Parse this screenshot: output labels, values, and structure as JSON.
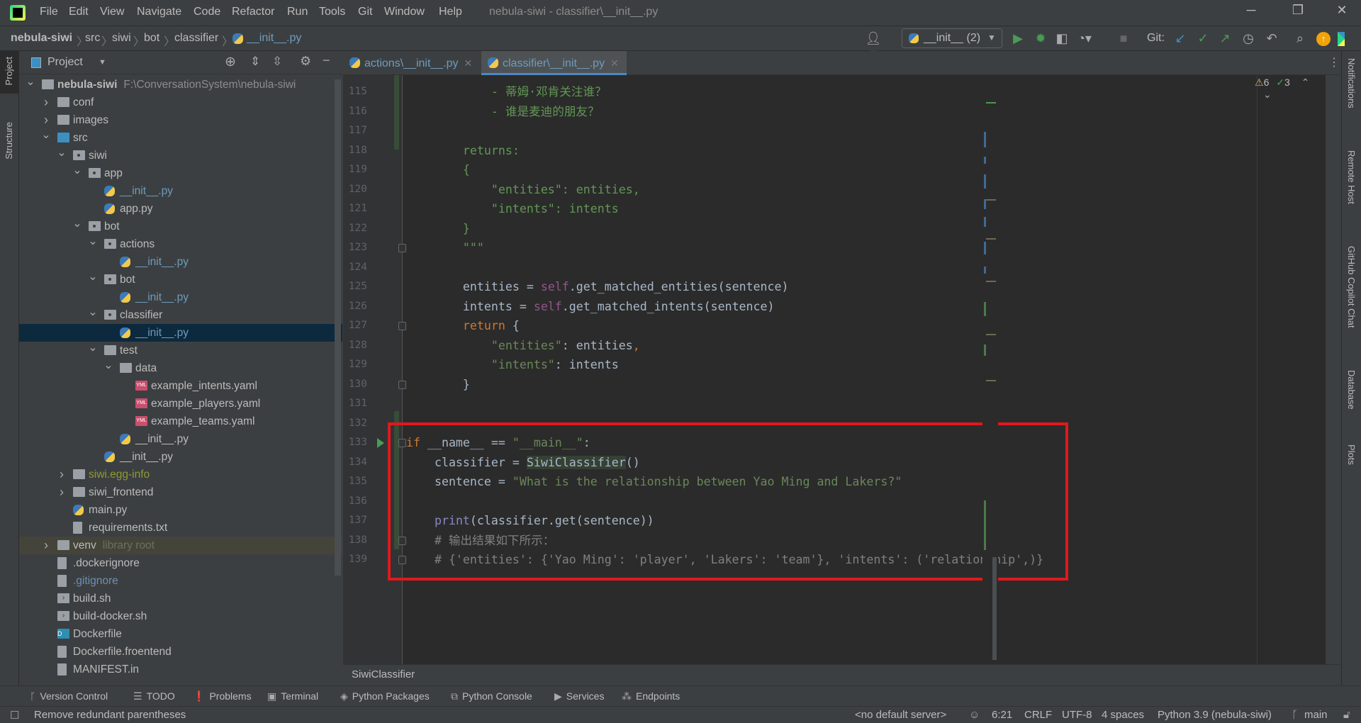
{
  "menu": [
    "File",
    "Edit",
    "View",
    "Navigate",
    "Code",
    "Refactor",
    "Run",
    "Tools",
    "Git",
    "Window",
    "Help"
  ],
  "window_title": "nebula-siwi - classifier\\__init__.py",
  "window_controls": {
    "minimize": "─",
    "restore": "❐",
    "close": "✕"
  },
  "breadcrumb": [
    "nebula-siwi",
    "src",
    "siwi",
    "bot",
    "classifier",
    "__init__.py"
  ],
  "toolbar": {
    "run_config": "__init__ (2)",
    "git_label": "Git:"
  },
  "left_stripe": {
    "project": "Project",
    "structure": "Structure"
  },
  "project_panel": {
    "title": "Project",
    "rows": [
      {
        "d": 0,
        "label": "nebula-siwi",
        "hint": "F:\\ConversationSystem\\nebula-siwi",
        "icon": "folder",
        "arrow": "down",
        "bold": true
      },
      {
        "d": 1,
        "label": "conf",
        "icon": "folder",
        "arrow": "right"
      },
      {
        "d": 1,
        "label": "images",
        "icon": "folder",
        "arrow": "right"
      },
      {
        "d": 1,
        "label": "src",
        "icon": "folder-blue",
        "arrow": "down"
      },
      {
        "d": 2,
        "label": "siwi",
        "icon": "pkg",
        "arrow": "down"
      },
      {
        "d": 3,
        "label": "app",
        "icon": "pkg",
        "arrow": "down"
      },
      {
        "d": 4,
        "label": "__init__.py",
        "icon": "py",
        "color": "#6d9cbe"
      },
      {
        "d": 4,
        "label": "app.py",
        "icon": "py"
      },
      {
        "d": 3,
        "label": "bot",
        "icon": "pkg",
        "arrow": "down"
      },
      {
        "d": 4,
        "label": "actions",
        "icon": "pkg",
        "arrow": "down"
      },
      {
        "d": 5,
        "label": "__init__.py",
        "icon": "py",
        "color": "#6d9cbe"
      },
      {
        "d": 4,
        "label": "bot",
        "icon": "pkg",
        "arrow": "down"
      },
      {
        "d": 5,
        "label": "__init__.py",
        "icon": "py",
        "color": "#6d9cbe"
      },
      {
        "d": 4,
        "label": "classifier",
        "icon": "pkg",
        "arrow": "down"
      },
      {
        "d": 5,
        "label": "__init__.py",
        "icon": "py",
        "color": "#6d9cbe",
        "selected": true
      },
      {
        "d": 4,
        "label": "test",
        "icon": "folder",
        "arrow": "down"
      },
      {
        "d": 5,
        "label": "data",
        "icon": "folder",
        "arrow": "down"
      },
      {
        "d": 6,
        "label": "example_intents.yaml",
        "icon": "yml"
      },
      {
        "d": 6,
        "label": "example_players.yaml",
        "icon": "yml"
      },
      {
        "d": 6,
        "label": "example_teams.yaml",
        "icon": "yml"
      },
      {
        "d": 5,
        "label": "__init__.py",
        "icon": "py"
      },
      {
        "d": 4,
        "label": "__init__.py",
        "icon": "py"
      },
      {
        "d": 2,
        "label": "siwi.egg-info",
        "icon": "folder",
        "arrow": "right",
        "color": "#8f9a2e"
      },
      {
        "d": 2,
        "label": "siwi_frontend",
        "icon": "folder",
        "arrow": "right"
      },
      {
        "d": 2,
        "label": "main.py",
        "icon": "py"
      },
      {
        "d": 2,
        "label": "requirements.txt",
        "icon": "txt"
      },
      {
        "d": 1,
        "label": "venv",
        "hint": "library root",
        "icon": "folder",
        "arrow": "right",
        "lib": true
      },
      {
        "d": 1,
        "label": ".dockerignore",
        "icon": "ign"
      },
      {
        "d": 1,
        "label": ".gitignore",
        "icon": "ign",
        "color": "#6d8fb5"
      },
      {
        "d": 1,
        "label": "build.sh",
        "icon": "sh"
      },
      {
        "d": 1,
        "label": "build-docker.sh",
        "icon": "sh"
      },
      {
        "d": 1,
        "label": "Dockerfile",
        "icon": "dock"
      },
      {
        "d": 1,
        "label": "Dockerfile.froentend",
        "icon": "txt"
      },
      {
        "d": 1,
        "label": "MANIFEST.in",
        "icon": "txt"
      }
    ]
  },
  "tabs": [
    {
      "label": "actions\\__init__.py",
      "active": false
    },
    {
      "label": "classifier\\__init__.py",
      "active": true
    }
  ],
  "inspections": {
    "warnings": "6",
    "typos": "3"
  },
  "code": [
    {
      "n": 115,
      "tokens": [
        [
          "            - 蒂姆·邓肯关注谁？",
          "doc"
        ]
      ]
    },
    {
      "n": 116,
      "tokens": [
        [
          "            - 谁是麦迪的朋友？",
          "doc"
        ]
      ]
    },
    {
      "n": 117,
      "tokens": []
    },
    {
      "n": 118,
      "tokens": [
        [
          "        returns:",
          "doc"
        ]
      ]
    },
    {
      "n": 119,
      "tokens": [
        [
          "        {",
          "doc"
        ]
      ]
    },
    {
      "n": 120,
      "tokens": [
        [
          "            \"entities\": entities,",
          "doc"
        ]
      ]
    },
    {
      "n": 121,
      "tokens": [
        [
          "            \"intents\": intents",
          "doc"
        ]
      ]
    },
    {
      "n": 122,
      "tokens": [
        [
          "        }",
          "doc"
        ]
      ]
    },
    {
      "n": 123,
      "tokens": [
        [
          "        \"\"\"",
          "doc"
        ]
      ]
    },
    {
      "n": 124,
      "tokens": []
    },
    {
      "n": 125,
      "tokens": [
        [
          "        entities = ",
          "d"
        ],
        [
          "self",
          "self"
        ],
        [
          ".get_matched_entities(sentence)",
          "d"
        ]
      ]
    },
    {
      "n": 126,
      "tokens": [
        [
          "        intents = ",
          "d"
        ],
        [
          "self",
          "self"
        ],
        [
          ".get_matched_intents(sentence)",
          "d"
        ]
      ]
    },
    {
      "n": 127,
      "tokens": [
        [
          "        return",
          "k"
        ],
        [
          " {",
          "d"
        ]
      ]
    },
    {
      "n": 128,
      "tokens": [
        [
          "            \"entities\"",
          "s"
        ],
        [
          ": entities",
          "d"
        ],
        [
          ",",
          "k"
        ]
      ]
    },
    {
      "n": 129,
      "tokens": [
        [
          "            \"intents\"",
          "s"
        ],
        [
          ": intents",
          "d"
        ]
      ]
    },
    {
      "n": 130,
      "tokens": [
        [
          "        }",
          "d"
        ]
      ]
    },
    {
      "n": 131,
      "tokens": []
    },
    {
      "n": 132,
      "tokens": []
    },
    {
      "n": 133,
      "tokens": [
        [
          "if",
          "k"
        ],
        [
          " __name__ == ",
          "d"
        ],
        [
          "\"__main__\"",
          "s"
        ],
        [
          ":",
          "d"
        ]
      ]
    },
    {
      "n": 134,
      "tokens": [
        [
          "    classifier = ",
          "d"
        ],
        [
          "SiwiClassifier",
          "hl"
        ],
        [
          "()",
          "d"
        ]
      ]
    },
    {
      "n": 135,
      "tokens": [
        [
          "    sentence = ",
          "d"
        ],
        [
          "\"What is the relationship between Yao Ming and Lakers?\"",
          "s"
        ]
      ]
    },
    {
      "n": 136,
      "tokens": []
    },
    {
      "n": 137,
      "tokens": [
        [
          "    ",
          "d"
        ],
        [
          "print",
          "fn"
        ],
        [
          "(classifier.get(sentence))",
          "d"
        ]
      ]
    },
    {
      "n": 138,
      "tokens": [
        [
          "    # 输出结果如下所示：",
          "cm"
        ]
      ]
    },
    {
      "n": 139,
      "tokens": [
        [
          "    # {'entities': {'Yao Ming': 'player', 'Lakers': 'team'}, 'intents': ('relationship',)}",
          "cm"
        ]
      ]
    }
  ],
  "editor_breadcrumb": "SiwiClassifier",
  "right_stripe": [
    "Notifications",
    "Remote Host",
    "GitHub Copilot Chat",
    "Database",
    "Plots"
  ],
  "tool_windows": [
    {
      "label": "Version Control",
      "icon": "ᚴ"
    },
    {
      "label": "TODO",
      "icon": "☰"
    },
    {
      "label": "Problems",
      "icon": "❗"
    },
    {
      "label": "Terminal",
      "icon": "▣"
    },
    {
      "label": "Python Packages",
      "icon": "◈"
    },
    {
      "label": "Python Console",
      "icon": "⧉"
    },
    {
      "label": "Services",
      "icon": "▶"
    },
    {
      "label": "Endpoints",
      "icon": "⁂"
    }
  ],
  "status": {
    "message": "Remove redundant parentheses",
    "server": "<no default server>",
    "position": "6:21",
    "line_sep": "CRLF",
    "encoding": "UTF-8",
    "indent": "4 spaces",
    "interpreter": "Python 3.9 (nebula-siwi)",
    "branch": "main"
  },
  "colors": {
    "accent": "#4a88c7",
    "highlight_box": "#e0191d",
    "run": "#499c54"
  }
}
